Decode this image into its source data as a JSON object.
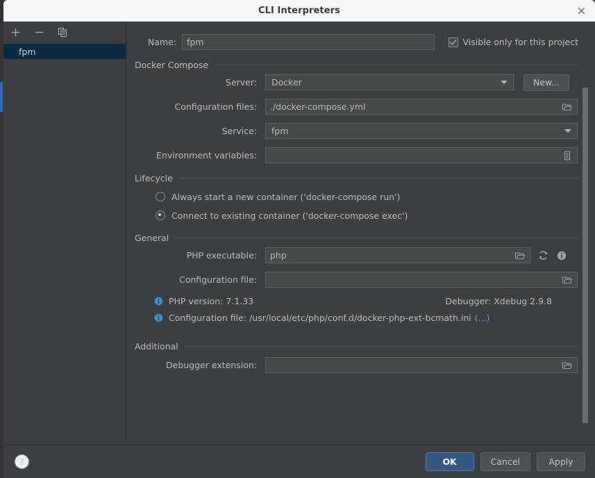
{
  "window": {
    "title": "CLI Interpreters",
    "close_icon": "close-icon"
  },
  "sidebar": {
    "toolbar": [
      {
        "name": "add-interpreter-button",
        "glyph": "+"
      },
      {
        "name": "remove-interpreter-button",
        "glyph": "−"
      },
      {
        "name": "copy-interpreter-button",
        "glyph": "copy-icon"
      }
    ],
    "items": [
      {
        "label": "fpm",
        "selected": true
      }
    ]
  },
  "form": {
    "name_label": "Name:",
    "name_value": "fpm",
    "visible_only_label": "Visible only for this project",
    "visible_only_checked": true
  },
  "docker_compose": {
    "group_title": "Docker Compose",
    "server_label": "Server:",
    "server_value": "Docker",
    "new_button": "New...",
    "config_files_label": "Configuration files:",
    "config_files_value": "./docker-compose.yml",
    "service_label": "Service:",
    "service_value": "fpm",
    "env_vars_label": "Environment variables:",
    "env_vars_value": ""
  },
  "lifecycle": {
    "group_title": "Lifecycle",
    "options": [
      {
        "label": "Always start a new container ('docker-compose run')",
        "selected": false
      },
      {
        "label": "Connect to existing container ('docker-compose exec')",
        "selected": true
      }
    ]
  },
  "general": {
    "group_title": "General",
    "php_executable_label": "PHP executable:",
    "php_executable_value": "php",
    "config_file_label": "Configuration file:",
    "config_file_value": "",
    "php_version_text": "PHP version: 7.1.33",
    "debugger_text": "Debugger:  Xdebug 2.9.8",
    "config_file_info_text": "Configuration file: /usr/local/etc/php/conf.d/docker-php-ext-bcmath.ini",
    "config_file_info_link": "(...)"
  },
  "additional": {
    "group_title": "Additional",
    "debugger_extension_label": "Debugger extension:",
    "debugger_extension_value": ""
  },
  "buttons": {
    "help": "?",
    "ok": "OK",
    "cancel": "Cancel",
    "apply": "Apply"
  },
  "colors": {
    "accent": "#365880",
    "link": "#589df6",
    "selection": "#0d293e",
    "window_bg": "#3c3f41",
    "field_bg": "#45494a"
  }
}
